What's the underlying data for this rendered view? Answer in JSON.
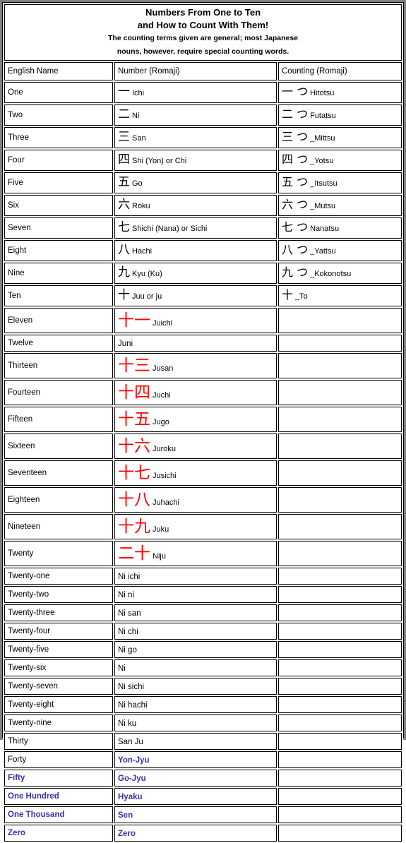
{
  "banner": {
    "title_line_1": "Numbers From One to Ten",
    "title_line_2": "and How to Count With Them!",
    "subtitle_line_1": "The counting terms given are general; most Japanese",
    "subtitle_line_2": "nouns, however, require special counting words."
  },
  "colors": {
    "kanji_black": "#000000",
    "kanji_red": "#ff0000",
    "highlight_blue": "#3333aa",
    "frame_gray": "#808080",
    "border_black": "#000000",
    "background": "#ffffff"
  },
  "columns": [
    {
      "label": "English Name"
    },
    {
      "label": "Number (Romaji)"
    },
    {
      "label": "Counting (Romaji)"
    }
  ],
  "rows": [
    {
      "english": "One",
      "number": {
        "kanji": "一",
        "romaji": "Ichi",
        "style": "black-kanji"
      },
      "counting": {
        "kanji": "一 つ",
        "romaji": "Hitotsu"
      }
    },
    {
      "english": "Two",
      "number": {
        "kanji": "二",
        "romaji": "Ni",
        "style": "black-kanji"
      },
      "counting": {
        "kanji": "二 つ",
        "romaji": "Futatsu"
      }
    },
    {
      "english": "Three",
      "number": {
        "kanji": "三",
        "romaji": "San",
        "style": "black-kanji"
      },
      "counting": {
        "kanji": "三 つ",
        "romaji": "_Mittsu"
      }
    },
    {
      "english": "Four",
      "number": {
        "kanji": "四",
        "romaji": "Shi (Yon) or Chi",
        "style": "black-kanji"
      },
      "counting": {
        "kanji": "四 つ",
        "romaji": "_Yotsu"
      }
    },
    {
      "english": "Five",
      "number": {
        "kanji": "五",
        "romaji": "Go",
        "style": "black-kanji"
      },
      "counting": {
        "kanji": "五 つ",
        "romaji": "_Itsutsu"
      }
    },
    {
      "english": "Six",
      "number": {
        "kanji": "六",
        "romaji": "Roku",
        "style": "black-kanji"
      },
      "counting": {
        "kanji": "六 つ",
        "romaji": "_Mutsu"
      }
    },
    {
      "english": "Seven",
      "number": {
        "kanji": "七",
        "romaji": "Shichi (Nana) or Sichi",
        "style": "black-kanji"
      },
      "counting": {
        "kanji": "七 つ",
        "romaji": "Nanatsu"
      }
    },
    {
      "english": "Eight",
      "number": {
        "kanji": "八",
        "romaji": "Hachi",
        "style": "black-kanji"
      },
      "counting": {
        "kanji": "八 つ",
        "romaji": "_Yattsu"
      }
    },
    {
      "english": "Nine",
      "number": {
        "kanji": "九",
        "romaji": "Kyu (Ku)",
        "style": "black-kanji"
      },
      "counting": {
        "kanji": "九 つ",
        "romaji": "_Kokonotsu"
      }
    },
    {
      "english": "Ten",
      "number": {
        "kanji": "十",
        "romaji": "Juu or ju",
        "style": "black-kanji"
      },
      "counting": {
        "kanji": "十",
        "romaji": "_To"
      }
    },
    {
      "english": "Eleven",
      "number": {
        "kanji": "十一",
        "romaji": "Juichi",
        "style": "red-kanji"
      },
      "counting": {
        "kanji": "",
        "romaji": ""
      }
    },
    {
      "english": "Twelve",
      "number": {
        "kanji": "",
        "romaji": "Juni",
        "style": "plain"
      },
      "counting": {
        "kanji": "",
        "romaji": ""
      }
    },
    {
      "english": "Thirteen",
      "number": {
        "kanji": "十三",
        "romaji": "Jusan",
        "style": "red-kanji"
      },
      "counting": {
        "kanji": "",
        "romaji": ""
      }
    },
    {
      "english": "Fourteen",
      "number": {
        "kanji": "十四",
        "romaji": "Juchi",
        "style": "red-kanji"
      },
      "counting": {
        "kanji": "",
        "romaji": ""
      }
    },
    {
      "english": "Fifteen",
      "number": {
        "kanji": "十五",
        "romaji": "Jugo",
        "style": "red-kanji"
      },
      "counting": {
        "kanji": "",
        "romaji": ""
      }
    },
    {
      "english": "Sixteen",
      "number": {
        "kanji": "十六",
        "romaji": "Juroku",
        "style": "red-kanji"
      },
      "counting": {
        "kanji": "",
        "romaji": ""
      }
    },
    {
      "english": "Seventeen",
      "number": {
        "kanji": "十七",
        "romaji": "Jusichi",
        "style": "red-kanji"
      },
      "counting": {
        "kanji": "",
        "romaji": ""
      }
    },
    {
      "english": "Eighteen",
      "number": {
        "kanji": "十八",
        "romaji": "Juhachi",
        "style": "red-kanji"
      },
      "counting": {
        "kanji": "",
        "romaji": ""
      }
    },
    {
      "english": "Nineteen",
      "number": {
        "kanji": "十九",
        "romaji": "Juku",
        "style": "red-kanji"
      },
      "counting": {
        "kanji": "",
        "romaji": ""
      }
    },
    {
      "english": "Twenty",
      "number": {
        "kanji": "二十",
        "romaji": "Niju",
        "style": "red-kanji"
      },
      "counting": {
        "kanji": "",
        "romaji": ""
      }
    },
    {
      "english": "Twenty-one",
      "number": {
        "kanji": "",
        "romaji": "Ni ichi",
        "style": "plain"
      },
      "counting": {
        "kanji": "",
        "romaji": ""
      }
    },
    {
      "english": "Twenty-two",
      "number": {
        "kanji": "",
        "romaji": "Ni ni",
        "style": "plain"
      },
      "counting": {
        "kanji": "",
        "romaji": ""
      }
    },
    {
      "english": "Twenty-three",
      "number": {
        "kanji": "",
        "romaji": "Ni san",
        "style": "plain"
      },
      "counting": {
        "kanji": "",
        "romaji": ""
      }
    },
    {
      "english": "Twenty-four",
      "number": {
        "kanji": "",
        "romaji": "Ni chi",
        "style": "plain"
      },
      "counting": {
        "kanji": "",
        "romaji": ""
      }
    },
    {
      "english": "Twenty-five",
      "number": {
        "kanji": "",
        "romaji": "Ni go",
        "style": "plain"
      },
      "counting": {
        "kanji": "",
        "romaji": ""
      }
    },
    {
      "english": "Twenty-six",
      "number": {
        "kanji": "",
        "romaji": "Ni",
        "style": "plain"
      },
      "counting": {
        "kanji": "",
        "romaji": ""
      }
    },
    {
      "english": "Twenty-seven",
      "number": {
        "kanji": "",
        "romaji": "Ni sichi",
        "style": "plain"
      },
      "counting": {
        "kanji": "",
        "romaji": ""
      }
    },
    {
      "english": "Twenty-eight",
      "number": {
        "kanji": "",
        "romaji": "Ni hachi",
        "style": "plain"
      },
      "counting": {
        "kanji": "",
        "romaji": ""
      }
    },
    {
      "english": "Twenty-nine",
      "number": {
        "kanji": "",
        "romaji": "Ni ku",
        "style": "plain"
      },
      "counting": {
        "kanji": "",
        "romaji": ""
      }
    },
    {
      "english": "Thirty",
      "number": {
        "kanji": "",
        "romaji": "San Ju",
        "style": "plain"
      },
      "counting": {
        "kanji": "",
        "romaji": ""
      }
    },
    {
      "english": "Forty",
      "number": {
        "kanji": "",
        "romaji": "Yon-Jyu",
        "style": "blue"
      },
      "counting": {
        "kanji": "",
        "romaji": ""
      }
    },
    {
      "english": "Fifty",
      "english_style": "blue",
      "number": {
        "kanji": "",
        "romaji": "Go-Jyu",
        "style": "blue"
      },
      "counting": {
        "kanji": "",
        "romaji": ""
      }
    },
    {
      "english": "One Hundred",
      "english_style": "blue",
      "number": {
        "kanji": "",
        "romaji": "Hyaku",
        "style": "blue"
      },
      "counting": {
        "kanji": "",
        "romaji": ""
      }
    },
    {
      "english": "One Thousand",
      "english_style": "blue",
      "number": {
        "kanji": "",
        "romaji": "Sen",
        "style": "blue"
      },
      "counting": {
        "kanji": "",
        "romaji": ""
      }
    },
    {
      "english": "Zero",
      "english_style": "blue",
      "number": {
        "kanji": "",
        "romaji": "Zero",
        "style": "blue"
      },
      "counting": {
        "kanji": "",
        "romaji": ""
      }
    }
  ]
}
